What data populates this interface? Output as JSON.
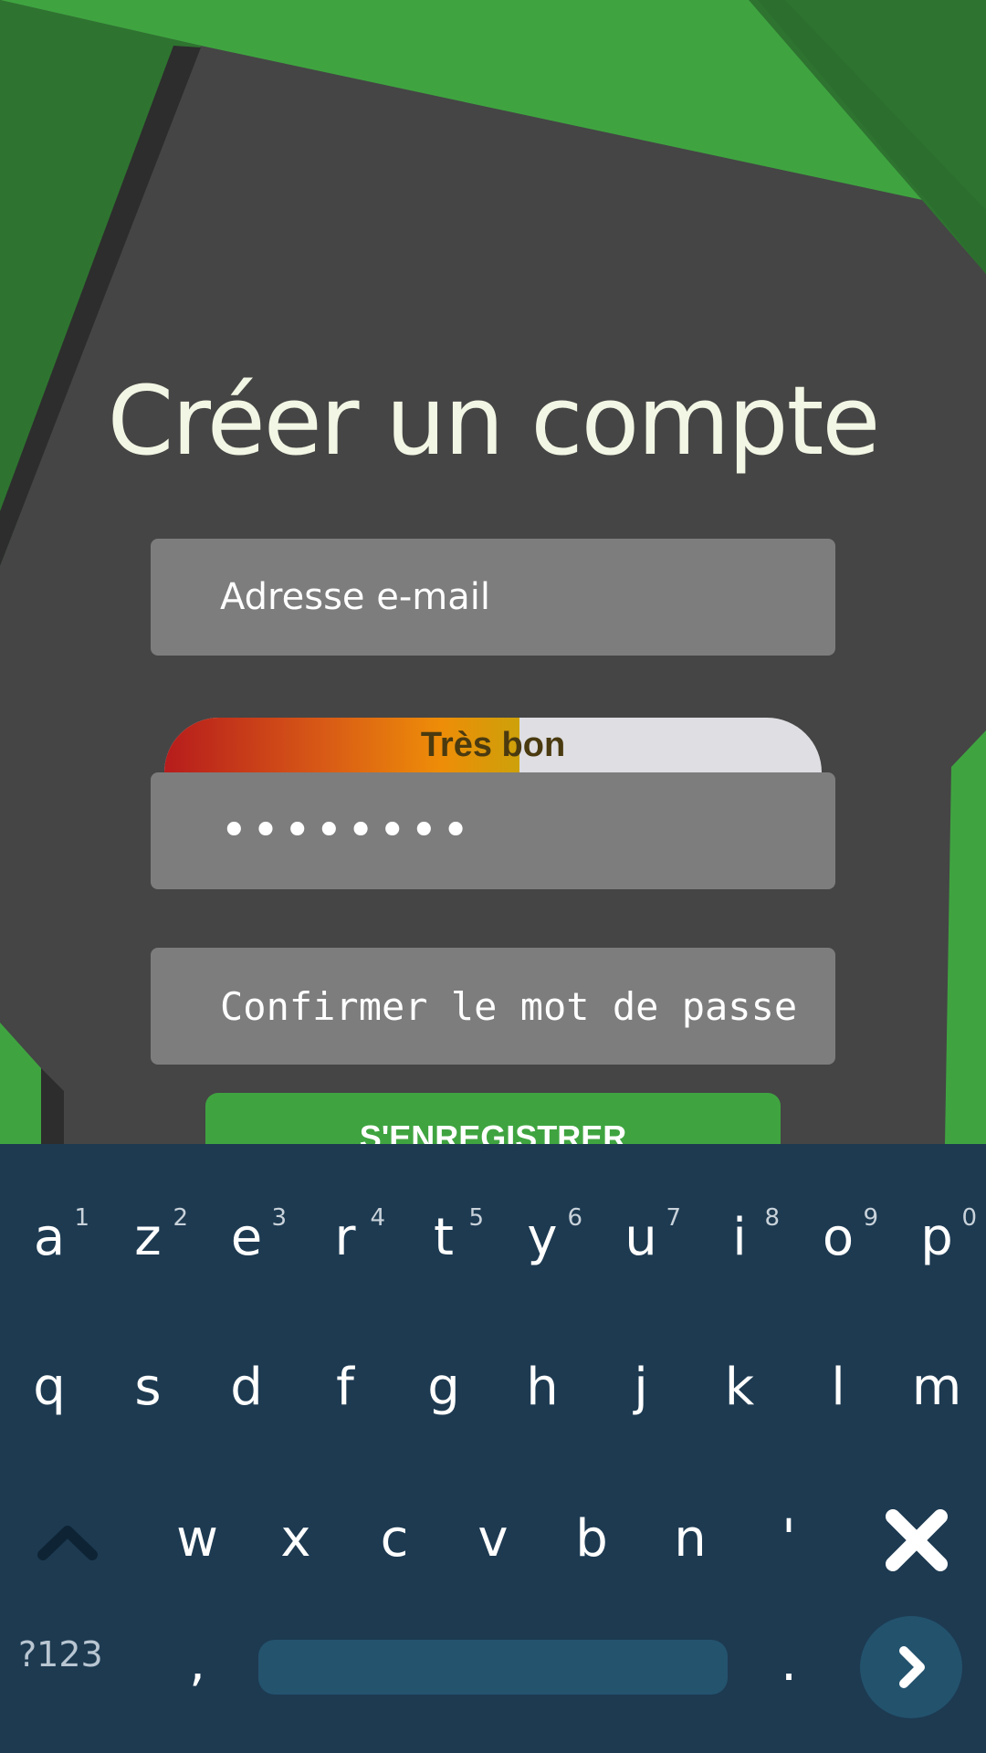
{
  "form": {
    "title": "Créer un compte",
    "email_placeholder": "Adresse e-mail",
    "password_value": "••••••••",
    "strength_label": "Très bon",
    "strength_level": 0.54,
    "confirm_placeholder": "Confirmer le mot de passe",
    "register_label": "S'ENREGISTRER"
  },
  "keyboard": {
    "row1": [
      {
        "key": "a",
        "hint": "1"
      },
      {
        "key": "z",
        "hint": "2"
      },
      {
        "key": "e",
        "hint": "3"
      },
      {
        "key": "r",
        "hint": "4"
      },
      {
        "key": "t",
        "hint": "5"
      },
      {
        "key": "y",
        "hint": "6"
      },
      {
        "key": "u",
        "hint": "7"
      },
      {
        "key": "i",
        "hint": "8"
      },
      {
        "key": "o",
        "hint": "9"
      },
      {
        "key": "p",
        "hint": "0"
      }
    ],
    "row2": [
      "q",
      "s",
      "d",
      "f",
      "g",
      "h",
      "j",
      "k",
      "l",
      "m"
    ],
    "row3": [
      "w",
      "x",
      "c",
      "v",
      "b",
      "n",
      "'"
    ],
    "symbols_label": "?123",
    "comma": ",",
    "period": ".",
    "shift_icon": "chevron-up-icon",
    "delete_icon": "close-icon",
    "enter_icon": "chevron-right-icon"
  },
  "colors": {
    "background": "#454545",
    "accent_green": "#3fa440",
    "dark_green": "#2e7430",
    "keyboard_bg": "#1d3a51",
    "title_color": "#f2f6e4"
  }
}
